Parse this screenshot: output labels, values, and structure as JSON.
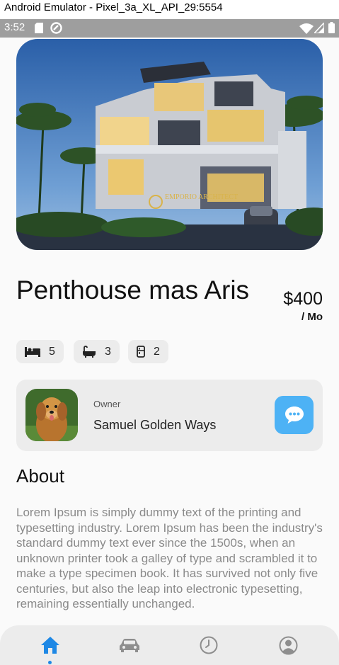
{
  "window": {
    "title": "Android Emulator - Pixel_3a_XL_API_29:5554"
  },
  "status_bar": {
    "time": "3:52"
  },
  "property": {
    "name": "Penthouse mas Aris",
    "price": "$400",
    "period": "/ Mo",
    "watermark": "EMPORIO ARCHITECT"
  },
  "features": [
    {
      "icon": "bed-icon",
      "count": "5"
    },
    {
      "icon": "bathtub-icon",
      "count": "3"
    },
    {
      "icon": "fridge-icon",
      "count": "2"
    }
  ],
  "owner": {
    "label": "Owner",
    "name": "Samuel Golden Ways"
  },
  "about": {
    "heading": "About",
    "text": "Lorem Ipsum is simply dummy text of the printing and typesetting industry. Lorem Ipsum has been the industry's standard dummy text ever since the 1500s, when an unknown printer took a galley of type and scrambled it to make a type specimen book. It has survived not only five centuries, but also the leap into electronic typesetting, remaining essentially unchanged."
  },
  "nav": {
    "items": [
      "home-icon",
      "car-icon",
      "clock-icon",
      "profile-icon"
    ],
    "active": "home-icon"
  },
  "colors": {
    "accent": "#1e88e5",
    "chat": "#4db2f5",
    "card": "#ececec"
  }
}
